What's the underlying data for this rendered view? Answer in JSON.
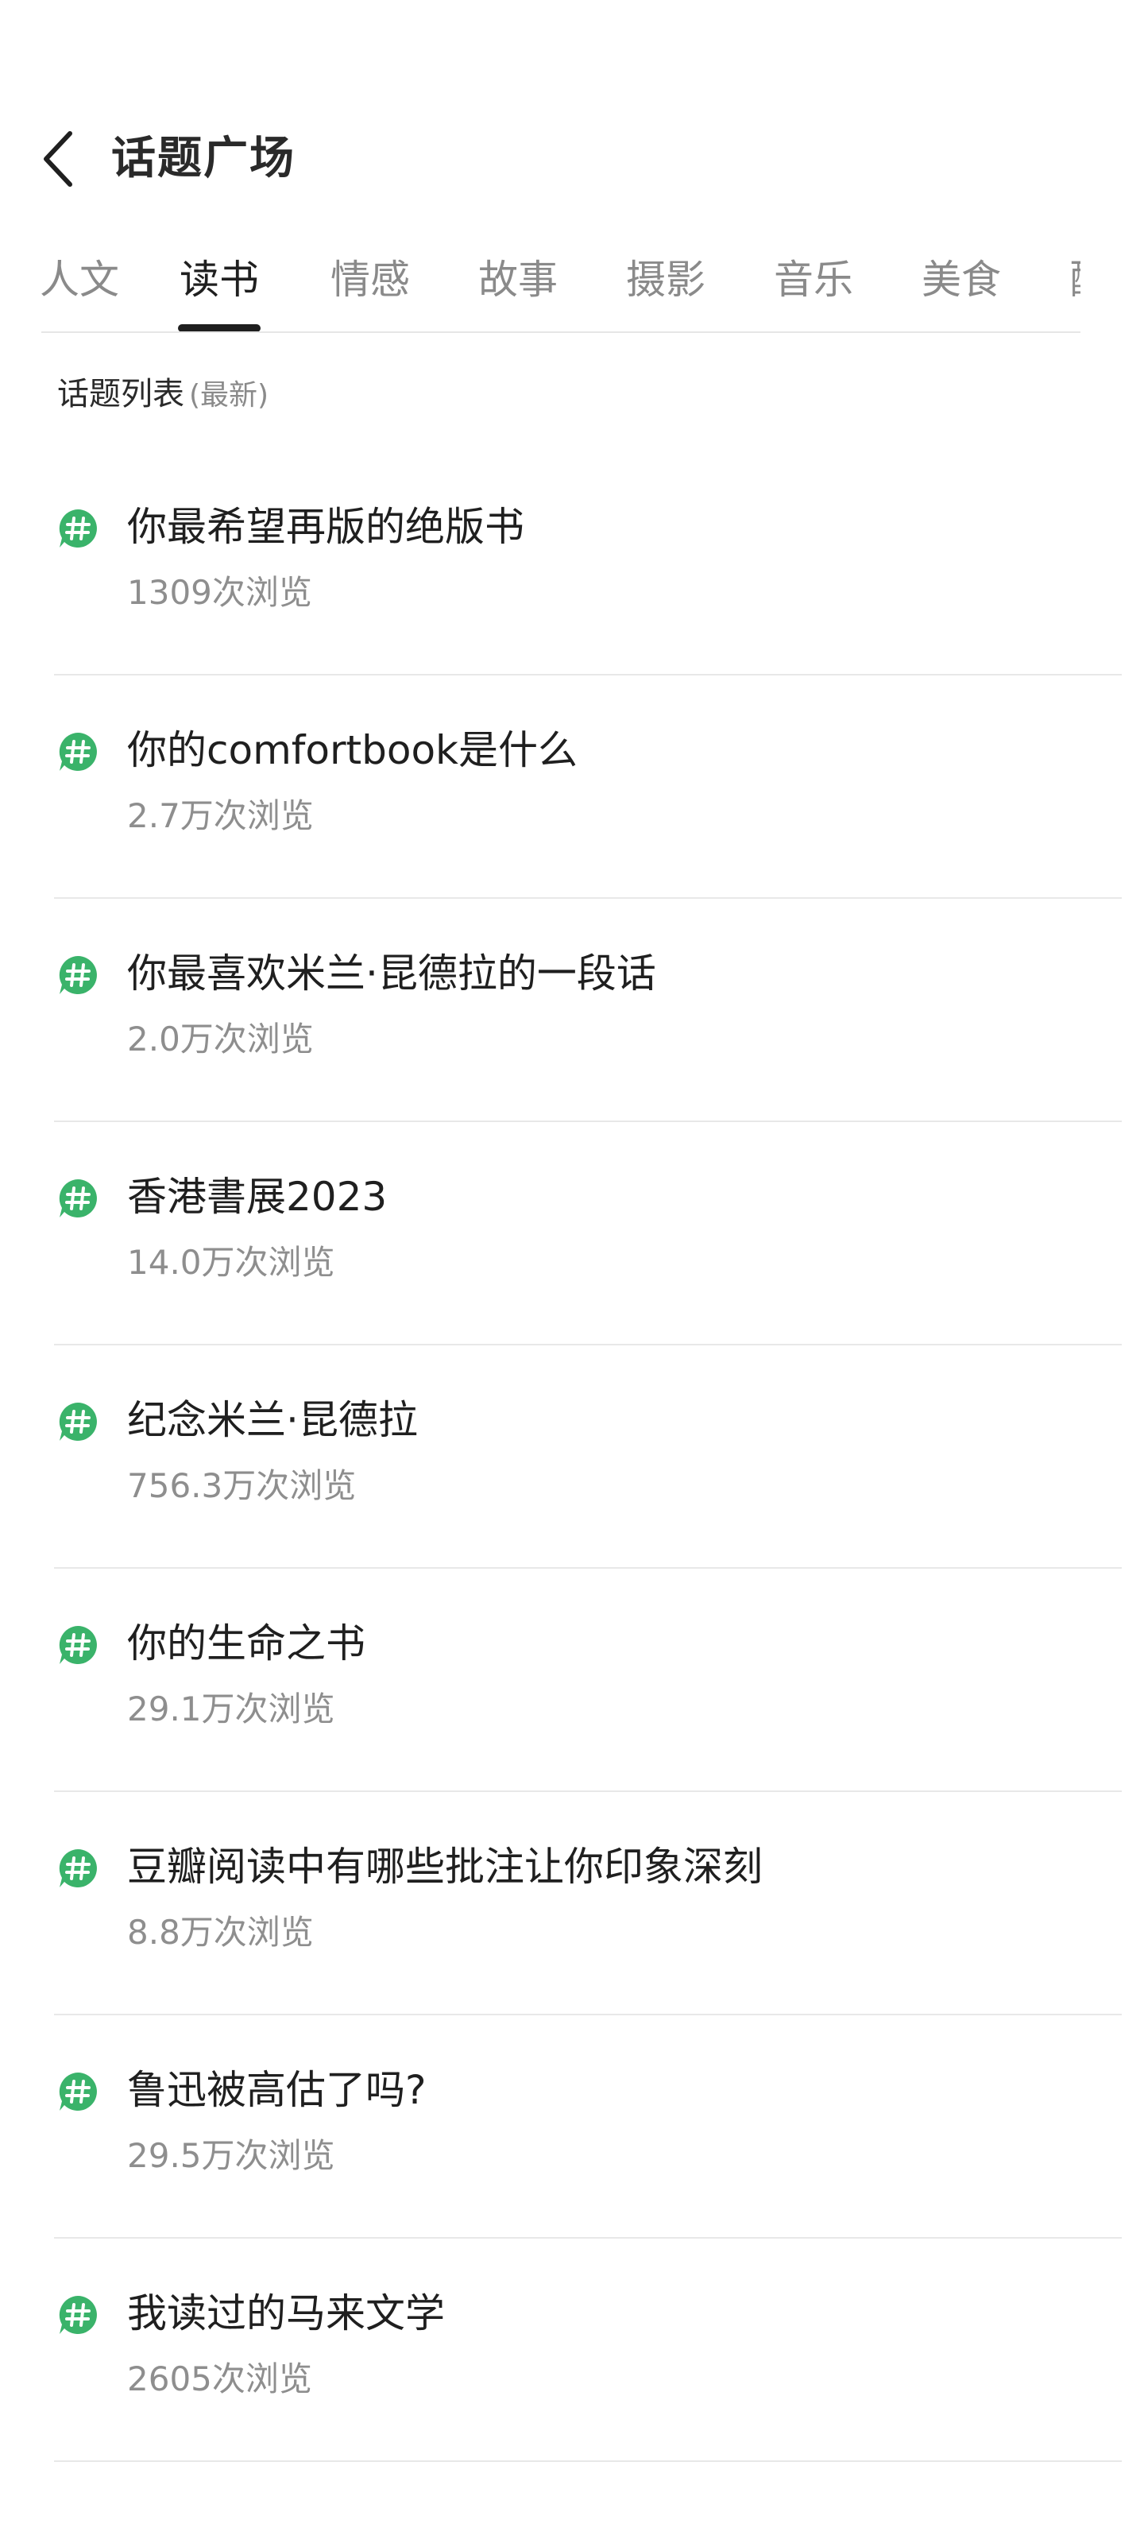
{
  "header": {
    "back_icon": "chevron-left-icon",
    "title": "话题广场"
  },
  "tabs": [
    {
      "label": "人文",
      "active": false
    },
    {
      "label": "读书",
      "active": true
    },
    {
      "label": "情感",
      "active": false
    },
    {
      "label": "故事",
      "active": false
    },
    {
      "label": "摄影",
      "active": false
    },
    {
      "label": "音乐",
      "active": false
    },
    {
      "label": "美食",
      "active": false
    },
    {
      "label": "配",
      "active": false
    }
  ],
  "section": {
    "title": "话题列表",
    "subtitle": "(最新)"
  },
  "topics": [
    {
      "title": "你最希望再版的绝版书",
      "views": "1309次浏览"
    },
    {
      "title": "你的comfortbook是什么",
      "views": "2.7万次浏览"
    },
    {
      "title": "你最喜欢米兰·昆德拉的一段话",
      "views": "2.0万次浏览"
    },
    {
      "title": "香港書展2023",
      "views": "14.0万次浏览"
    },
    {
      "title": "纪念米兰·昆德拉",
      "views": "756.3万次浏览"
    },
    {
      "title": "你的生命之书",
      "views": "29.1万次浏览"
    },
    {
      "title": "豆瓣阅读中有哪些批注让你印象深刻",
      "views": "8.8万次浏览"
    },
    {
      "title": "鲁迅被高估了吗?",
      "views": "29.5万次浏览"
    },
    {
      "title": "我读过的马来文学",
      "views": "2605次浏览"
    }
  ],
  "colors": {
    "accent_green": "#3ab36a",
    "text_primary": "#1f1f1f",
    "text_secondary": "#8e8e8e",
    "divider": "#e8e8e8"
  },
  "icons": {
    "topic": "hashtag-bubble-icon"
  }
}
